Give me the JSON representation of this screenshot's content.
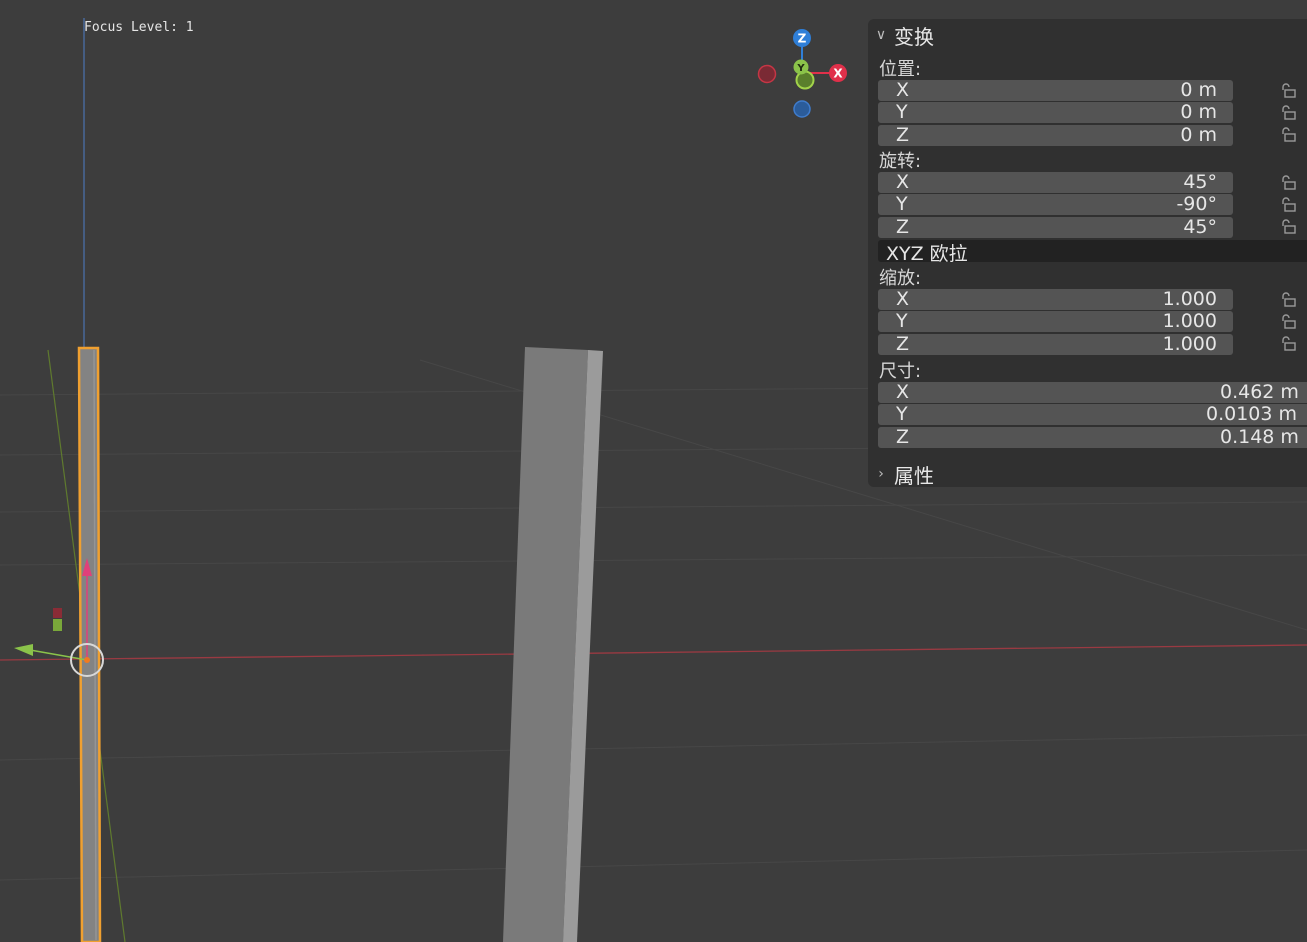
{
  "viewport": {
    "focus_level": "Focus Level: 1"
  },
  "gizmo": {
    "z_label": "Z",
    "y_label": "Y",
    "x_label": "X",
    "colors": {
      "x": "#e0304a",
      "y": "#8bc34a",
      "z": "#2f7fd8"
    }
  },
  "panel": {
    "transform_header": "变换",
    "properties_header": "属性",
    "location": {
      "label": "位置:",
      "x": {
        "axis": "X",
        "value": "0 m"
      },
      "y": {
        "axis": "Y",
        "value": "0 m"
      },
      "z": {
        "axis": "Z",
        "value": "0 m"
      }
    },
    "rotation": {
      "label": "旋转:",
      "x": {
        "axis": "X",
        "value": "45°"
      },
      "y": {
        "axis": "Y",
        "value": "-90°"
      },
      "z": {
        "axis": "Z",
        "value": "45°"
      },
      "mode": "XYZ 欧拉"
    },
    "scale": {
      "label": "缩放:",
      "x": {
        "axis": "X",
        "value": "1.000"
      },
      "y": {
        "axis": "Y",
        "value": "1.000"
      },
      "z": {
        "axis": "Z",
        "value": "1.000"
      }
    },
    "dimensions": {
      "label": "尺寸:",
      "x": {
        "axis": "X",
        "value": "0.462 m"
      },
      "y": {
        "axis": "Y",
        "value": "0.0103 m"
      },
      "z": {
        "axis": "Z",
        "value": "0.148 m"
      }
    }
  },
  "colors": {
    "selection_outline": "#f0a030",
    "background": "#3d3d3d",
    "panel": "#303030"
  }
}
